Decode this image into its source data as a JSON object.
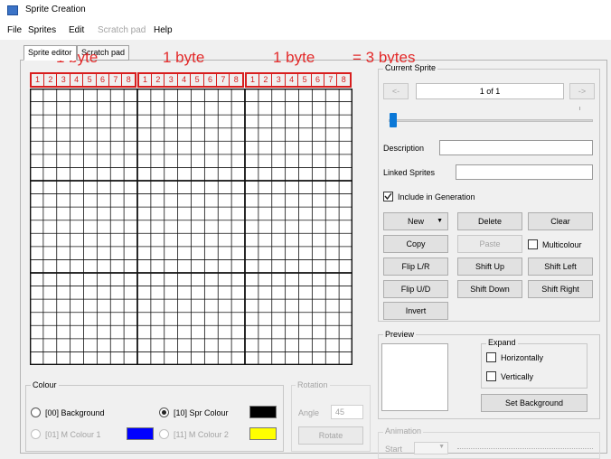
{
  "window": {
    "title": "Sprite Creation"
  },
  "menu": [
    "File",
    "Sprites",
    "Edit",
    "Scratch pad",
    "Help"
  ],
  "tabs": {
    "sprite_editor": "Sprite editor",
    "scratch_pad": "Scratch pad"
  },
  "annotation": {
    "byte_labels": [
      "1 byte",
      "1 byte",
      "1 byte"
    ],
    "total": "= 3 bytes",
    "bits": [
      "1",
      "2",
      "3",
      "4",
      "5",
      "6",
      "7",
      "8"
    ],
    "color": "#d81e1e"
  },
  "grid": {
    "columns": 24,
    "rows": 21
  },
  "current_sprite": {
    "label": "Current Sprite",
    "prev": "<-",
    "next": "->",
    "counter": "1 of 1",
    "description_label": "Description",
    "description_value": "",
    "linked_label": "Linked Sprites",
    "linked_value": "",
    "include_label": "Include in Generation",
    "include_checked": true
  },
  "buttons": {
    "new": "New",
    "delete": "Delete",
    "clear": "Clear",
    "copy": "Copy",
    "paste": "Paste",
    "multicolour": "Multicolour",
    "flip_lr": "Flip L/R",
    "shift_up": "Shift Up",
    "shift_left": "Shift Left",
    "flip_ud": "Flip U/D",
    "shift_down": "Shift Down",
    "shift_right": "Shift Right",
    "invert": "Invert"
  },
  "preview": {
    "label": "Preview",
    "expand_label": "Expand",
    "horizontally": "Horizontally",
    "vertically": "Vertically",
    "set_background": "Set Background"
  },
  "colour": {
    "label": "Colour",
    "background": "[00] Background",
    "spr_colour": "[10] Spr Colour",
    "m_colour_1": "[01] M Colour 1",
    "m_colour_2": "[11] M Colour 2",
    "swatch_spr": "#000000",
    "swatch_m1": "#0000ff",
    "swatch_m2": "#ffff00"
  },
  "rotation": {
    "label": "Rotation",
    "angle_label": "Angle",
    "angle_value": "45",
    "rotate": "Rotate"
  },
  "animation": {
    "label": "Animation",
    "start_label": "Start"
  }
}
